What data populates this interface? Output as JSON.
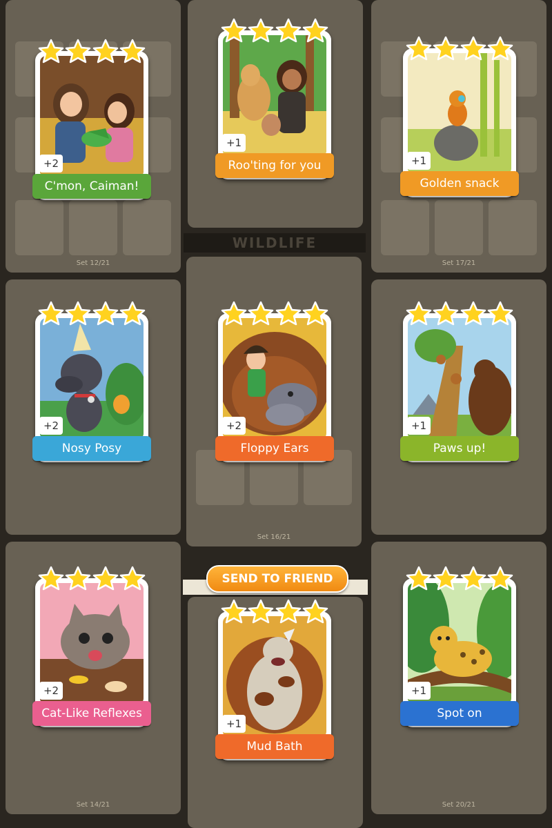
{
  "colors": {
    "green": "#5aa63a",
    "orange": "#f09a25",
    "blue": "#3aa7d8",
    "orange_red": "#ef6a2a",
    "lime": "#8bb52a",
    "pink": "#ea5f8f",
    "royal_blue": "#2b72d1"
  },
  "send_to_friend": {
    "label": "SEND TO FRIEND"
  },
  "background_album": {
    "band_title": "WILDLIFE",
    "set_labels": [
      "Set 12/21",
      "Set 17/21",
      "Set 16/21",
      "Set 14/21",
      "Set 20/21"
    ]
  },
  "cards": [
    {
      "name": "C'mon, Caiman!",
      "count": "+2",
      "stars": 4,
      "banner_color": "green",
      "art_icon": "caiman-illustration"
    },
    {
      "name": "Roo'ting for you",
      "count": "+1",
      "stars": 4,
      "banner_color": "orange",
      "art_icon": "kangaroo-illustration"
    },
    {
      "name": "Golden snack",
      "count": "+1",
      "stars": 4,
      "banner_color": "orange",
      "art_icon": "monkey-illustration"
    },
    {
      "name": "Nosy Posy",
      "count": "+2",
      "stars": 4,
      "banner_color": "blue",
      "art_icon": "dog-illustration"
    },
    {
      "name": "Floppy Ears",
      "count": "+2",
      "stars": 4,
      "banner_color": "orange_red",
      "art_icon": "hippo-illustration"
    },
    {
      "name": "Paws up!",
      "count": "+1",
      "stars": 4,
      "banner_color": "lime",
      "art_icon": "bear-illustration"
    },
    {
      "name": "Cat-Like Reflexes",
      "count": "+2",
      "stars": 4,
      "banner_color": "pink",
      "art_icon": "cat-illustration"
    },
    {
      "name": "Mud Bath",
      "count": "+1",
      "stars": 4,
      "banner_color": "orange_red",
      "art_icon": "rhino-illustration"
    },
    {
      "name": "Spot on",
      "count": "+1",
      "stars": 4,
      "banner_color": "royal_blue",
      "art_icon": "leopard-illustration"
    }
  ]
}
